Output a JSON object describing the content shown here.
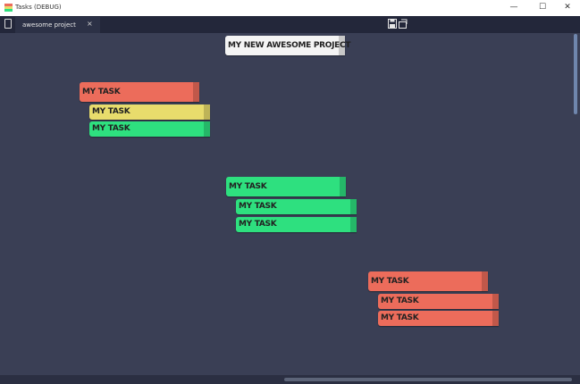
{
  "window": {
    "title": "Tasks (DEBUG)",
    "minimize": "—",
    "maximize": "☐",
    "close": "✕"
  },
  "tabs": [
    {
      "label": "awesome project",
      "close": "×"
    }
  ],
  "toolbar": {
    "save_icon": "💾",
    "export_icon": "⎘"
  },
  "project": {
    "title": "MY NEW AWESOME PROJECT"
  },
  "groups": [
    {
      "parent": {
        "label": "MY TASK",
        "status": "red"
      },
      "children": [
        {
          "label": "MY TASK",
          "status": "yellow"
        },
        {
          "label": "MY TASK",
          "status": "green"
        }
      ]
    },
    {
      "parent": {
        "label": "MY TASK",
        "status": "green"
      },
      "children": [
        {
          "label": "MY TASK",
          "status": "green"
        },
        {
          "label": "MY TASK",
          "status": "green"
        }
      ]
    },
    {
      "parent": {
        "label": "MY TASK",
        "status": "red"
      },
      "children": [
        {
          "label": "MY TASK",
          "status": "red"
        },
        {
          "label": "MY TASK",
          "status": "red"
        }
      ]
    }
  ],
  "colors": {
    "background": "#3a3f55",
    "red": "#ec6c5b",
    "yellow": "#e8dc6c",
    "green": "#2ee07f",
    "project": "#f4f4f4"
  }
}
